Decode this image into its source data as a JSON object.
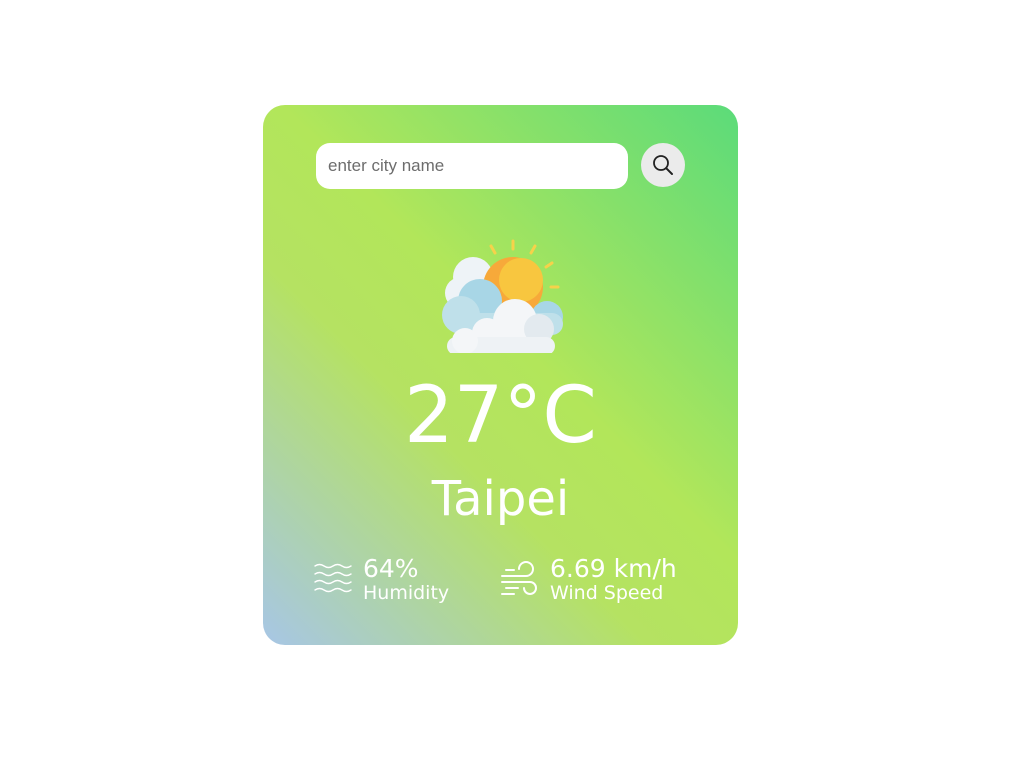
{
  "search": {
    "placeholder": "enter city name",
    "value": ""
  },
  "weather": {
    "icon": "partly-cloudy-icon",
    "temperature": "27°C",
    "city": "Taipei"
  },
  "details": {
    "humidity": {
      "icon": "humidity-waves-icon",
      "value": "64%",
      "label": "Humidity"
    },
    "wind": {
      "icon": "wind-icon",
      "value": "6.69 km/h",
      "label": "Wind Speed"
    }
  },
  "colors": {
    "gradient_top_right": "#5bdb7a",
    "gradient_middle": "#b2e65a",
    "gradient_bottom_left": "#a7c6e6",
    "text": "#ffffff"
  }
}
